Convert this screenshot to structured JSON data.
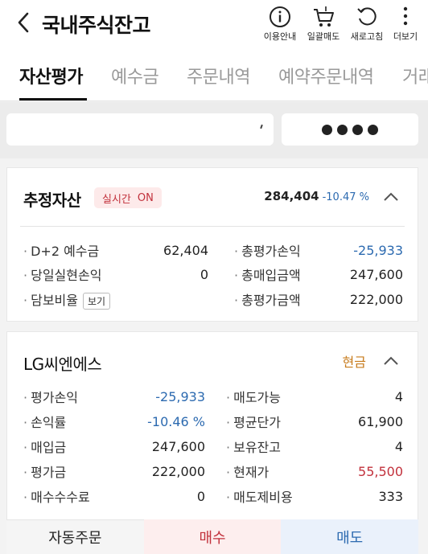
{
  "header": {
    "title": "국내주식잔고",
    "buttons": [
      {
        "label": "이용안내",
        "icon": "info-icon"
      },
      {
        "label": "일괄매도",
        "icon": "cart-icon"
      },
      {
        "label": "새로고침",
        "icon": "refresh-icon"
      },
      {
        "label": "더보기",
        "icon": "more-icon"
      }
    ]
  },
  "tabs": [
    "자산평가",
    "예수금",
    "주문내역",
    "예약주문내역",
    "거래"
  ],
  "summary": {
    "title": "추정자산",
    "realtime_label": "실시간",
    "realtime_state": "ON",
    "total": "284,404",
    "total_pct": "-10.47 %",
    "left": [
      {
        "label": "D+2 예수금",
        "value": "62,404"
      },
      {
        "label": "당일실현손익",
        "value": "0"
      },
      {
        "label": "담보비율",
        "button": "보기"
      }
    ],
    "right": [
      {
        "label": "총평가손익",
        "value": "-25,933"
      },
      {
        "label": "총매입금액",
        "value": "247,600"
      },
      {
        "label": "총평가금액",
        "value": "222,000"
      }
    ]
  },
  "holding": {
    "name": "LG씨엔에스",
    "type": "현금",
    "left": [
      {
        "label": "평가손익",
        "value": "-25,933"
      },
      {
        "label": "손익률",
        "value": "-10.46 %"
      },
      {
        "label": "매입금",
        "value": "247,600"
      },
      {
        "label": "평가금",
        "value": "222,000"
      },
      {
        "label": "매수수수료",
        "value": "0"
      }
    ],
    "right": [
      {
        "label": "매도가능",
        "value": "4"
      },
      {
        "label": "평균단가",
        "value": "61,900"
      },
      {
        "label": "보유잔고",
        "value": "4"
      },
      {
        "label": "현재가",
        "value": "55,500"
      },
      {
        "label": "매도제비용",
        "value": "333"
      }
    ]
  },
  "footer": {
    "auto_order": "자동주문",
    "buy": "매수",
    "sell": "매도"
  },
  "colors": {
    "negative": "#2c6ab0",
    "positive": "#c2313c",
    "cash": "#c77b1c"
  }
}
